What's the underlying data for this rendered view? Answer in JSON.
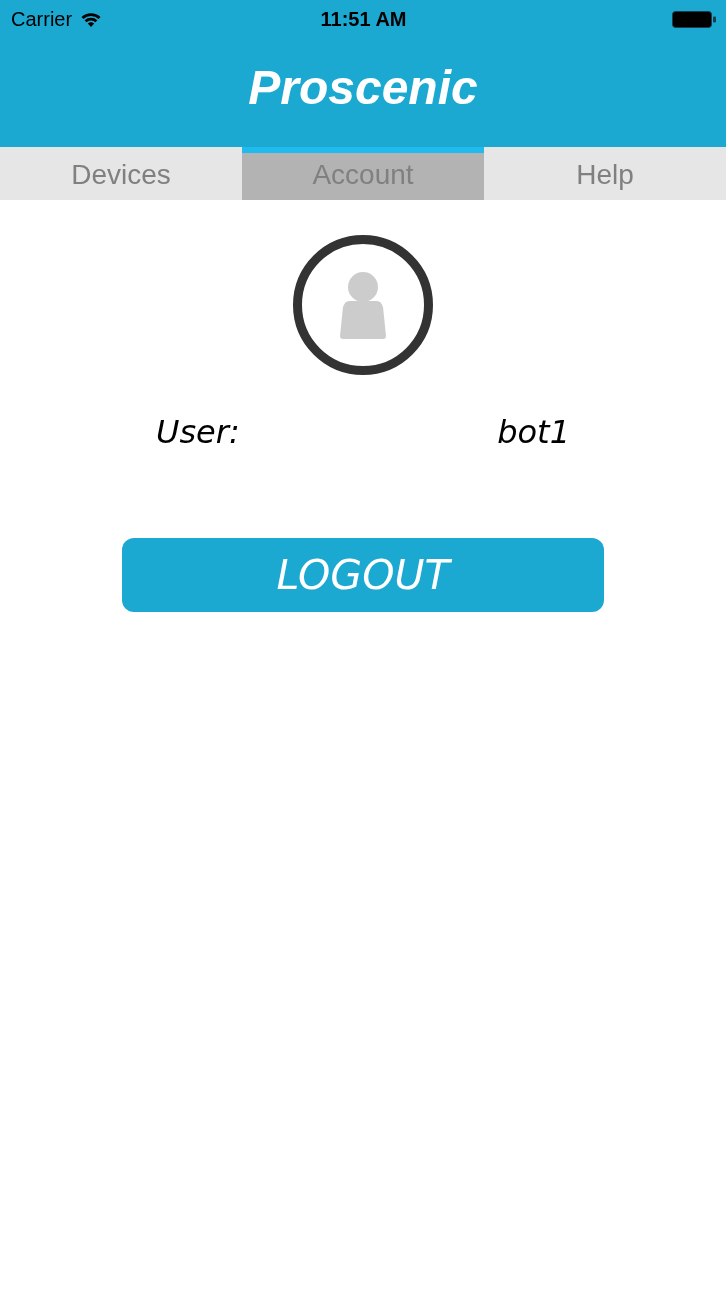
{
  "status_bar": {
    "carrier": "Carrier",
    "time": "11:51 AM"
  },
  "header": {
    "logo": "Proscenic"
  },
  "tabs": [
    {
      "label": "Devices",
      "selected": false
    },
    {
      "label": "Account",
      "selected": true
    },
    {
      "label": "Help",
      "selected": false
    }
  ],
  "account": {
    "user_label": "User:",
    "username": "bot1"
  },
  "buttons": [
    {
      "label": "LOGOUT"
    }
  ]
}
